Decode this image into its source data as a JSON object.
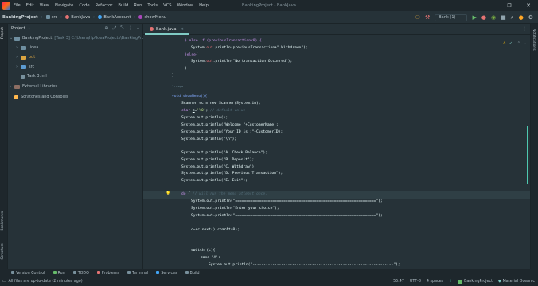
{
  "menu": [
    "File",
    "Edit",
    "View",
    "Navigate",
    "Code",
    "Refactor",
    "Build",
    "Run",
    "Tools",
    "VCS",
    "Window",
    "Help"
  ],
  "window_title": "BankingProject - BankJava",
  "breadcrumbs": [
    "BankingProject",
    "src",
    "BankJava",
    "BankAccount",
    "showMenu"
  ],
  "run_config": "Bank (1)",
  "project_panel": {
    "title": "Project",
    "tree": [
      {
        "label": "BankingProject",
        "extra": "[Task 3]  C:\\Users\\Hp\\IdeaProjects\\BankingProject"
      },
      {
        "label": ".idea"
      },
      {
        "label": "out"
      },
      {
        "label": "src"
      },
      {
        "label": "Task 3.iml"
      },
      {
        "label": "External Libraries"
      },
      {
        "label": "Scratches and Consoles"
      }
    ]
  },
  "editor_tab": "Bank.java",
  "code": {
    "l1": "} else if (previousTransaction<0) {",
    "l2a": "System.",
    "l2b": "out",
    "l2c": ".println(previousTransaction+\" Withdrawn\");",
    "l3": "}else{",
    "l4a": "System.",
    "l4b": "out",
    "l4c": ".println(\"No transaction Occurred\");",
    "l5": "}",
    "l6": "}",
    "usage": "1 usage",
    "l7": "void showMenu(){",
    "l8": "Scanner sc = new Scanner(System.in);",
    "l9a": "char ",
    "l9b": "c",
    "l9c": "=",
    "l9d": "'\\0'",
    "l9e": ";",
    "l9f": " // default value",
    "l10": "System.out.println();",
    "l11": "System.out.println(\"Welcome \"+CustomerName);",
    "l12": "System.out.println(\"Your ID is :\"+CustomerID);",
    "l13": "System.out.println(\"\\n\");",
    "l14": "System.out.println(\"A. Check Balance\");",
    "l15": "System.out.println(\"B. Deposit\");",
    "l16": "System.out.println(\"C. Withdraw\");",
    "l17": "System.out.println(\"D. Previous Transaction\");",
    "l18": "System.out.println(\"E. Exit\");",
    "l19a": "do ",
    "l19b": "{",
    "l19c": " // will run the menu atleast once.",
    "l20": "System.out.println(\"================================================================\");",
    "l21": "System.out.println(\"Enter your choice\");",
    "l22": "System.out.println(\"================================================================\");",
    "l23": "c=sc.next().charAt(0);",
    "l24": "switch (c){",
    "l25": "case 'A':",
    "l26": "System.out.println(\"----------------------------------------------------------------\");"
  },
  "bottom_tools": [
    "Version Control",
    "Run",
    "TODO",
    "Problems",
    "Terminal",
    "Services",
    "Build"
  ],
  "status": {
    "message": "All files are up-to-date (2 minutes ago)",
    "position": "55:47",
    "encoding": "UTF-8",
    "indent": "4 spaces",
    "project": "BankingProject",
    "theme": "Material Oceanic"
  },
  "colors": {
    "accent": "#80cbc4",
    "background": "#263238",
    "keyword": "#c792ea",
    "string": "#c3e88d"
  }
}
